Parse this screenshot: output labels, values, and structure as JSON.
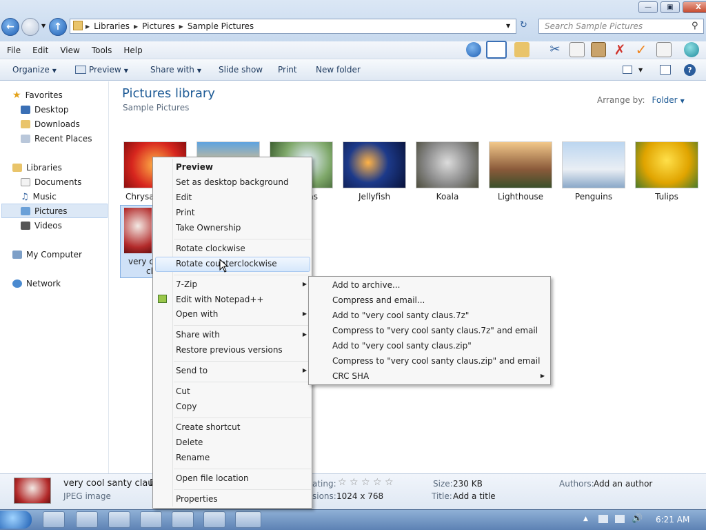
{
  "window": {
    "breadcrumbs": [
      "Libraries",
      "Pictures",
      "Sample Pictures"
    ],
    "search_placeholder": "Search Sample Pictures",
    "minimize": "—",
    "maximize": "▣",
    "close": "X"
  },
  "menubar": [
    "File",
    "Edit",
    "View",
    "Tools",
    "Help"
  ],
  "commandbar": {
    "organize": "Organize",
    "preview": "Preview",
    "share_with": "Share with",
    "slide_show": "Slide show",
    "print": "Print",
    "new_folder": "New folder"
  },
  "nav": {
    "favorites": "Favorites",
    "desktop": "Desktop",
    "downloads": "Downloads",
    "recent_places": "Recent Places",
    "libraries": "Libraries",
    "documents": "Documents",
    "music": "Music",
    "pictures": "Pictures",
    "videos": "Videos",
    "my_computer": "My Computer",
    "network": "Network"
  },
  "content": {
    "title": "Pictures library",
    "subtitle": "Sample Pictures",
    "arrange_by_label": "Arrange by:",
    "arrange_by_value": "Folder",
    "thumbnails": [
      "Chrysanthemum",
      "Desert",
      "Hydrangeas",
      "Jellyfish",
      "Koala",
      "Lighthouse",
      "Penguins",
      "Tulips"
    ],
    "visible_labels": {
      "chrysanthemum": "Chrysan",
      "hydrangeas": "eas",
      "jellyfish": "Jellyfish",
      "koala": "Koala",
      "lighthouse": "Lighthouse",
      "penguins": "Penguins",
      "tulips": "Tulips"
    },
    "selected_item_label_1": "very co",
    "selected_item_label_2": "cl"
  },
  "context_menu": {
    "preview": "Preview",
    "set_desktop_background": "Set as desktop background",
    "edit": "Edit",
    "print": "Print",
    "take_ownership": "Take Ownership",
    "rotate_clockwise": "Rotate clockwise",
    "rotate_counterclockwise": "Rotate counterclockwise",
    "seven_zip": "7-Zip",
    "edit_notepad": "Edit with Notepad++",
    "open_with": "Open with",
    "share_with": "Share with",
    "restore_previous": "Restore previous versions",
    "send_to": "Send to",
    "cut": "Cut",
    "copy": "Copy",
    "create_shortcut": "Create shortcut",
    "delete": "Delete",
    "rename": "Rename",
    "open_file_location": "Open file location",
    "properties": "Properties"
  },
  "submenu_7zip": {
    "add_to_archive": "Add to archive...",
    "compress_email": "Compress and email...",
    "add_7z": "Add to \"very cool santy claus.7z\"",
    "compress_7z_email": "Compress to \"very cool santy claus.7z\" and email",
    "add_zip": "Add to \"very cool santy claus.zip\"",
    "compress_zip_email": "Compress to \"very cool santy claus.zip\" and email",
    "crc_sha": "CRC SHA"
  },
  "details": {
    "filename": "very cool santy claus",
    "filename_suffix": "D",
    "filetype": "JPEG image",
    "rating_label": "ating:",
    "dimensions_label": "sions:",
    "dimensions_value": "1024 x 768",
    "size_label": "Size:",
    "size_value": "230 KB",
    "title_label": "Title:",
    "title_value": "Add a title",
    "authors_label": "Authors:",
    "authors_value": "Add an author",
    "rating_stars": "☆ ☆ ☆ ☆ ☆"
  },
  "taskbar": {
    "clock": "6:21 AM",
    "tray_up": "▲"
  },
  "colors": {
    "accent": "#1e5b96",
    "selection": "#cfe1f7"
  }
}
